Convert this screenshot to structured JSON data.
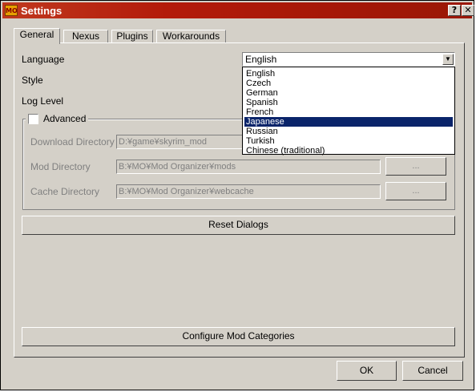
{
  "window": {
    "title": "Settings",
    "icon_text": "MO",
    "help_label": "?",
    "close_label": "✕"
  },
  "tabs": [
    "General",
    "Nexus",
    "Plugins",
    "Workarounds"
  ],
  "general": {
    "language_label": "Language",
    "language_value": "English",
    "style_label": "Style",
    "log_level_label": "Log Level",
    "advanced_label": "Advanced",
    "advanced_checked": false,
    "download_dir_label": "Download Directory",
    "download_dir_value": "D:¥game¥skyrim_mod",
    "mod_dir_label": "Mod Directory",
    "mod_dir_value": "B:¥MO¥Mod Organizer¥mods",
    "cache_dir_label": "Cache Directory",
    "cache_dir_value": "B:¥MO¥Mod Organizer¥webcache",
    "browse_label": "...",
    "reset_dialogs_label": "Reset Dialogs",
    "configure_categories_label": "Configure Mod Categories"
  },
  "language_dropdown": {
    "options": [
      "English",
      "Czech",
      "German",
      "Spanish",
      "French",
      "Japanese",
      "Russian",
      "Turkish",
      "Chinese (traditional)"
    ],
    "highlighted": "Japanese"
  },
  "footer": {
    "ok_label": "OK",
    "cancel_label": "Cancel"
  },
  "colors": {
    "title_bar": "#b31a0a",
    "selection": "#0a246a",
    "face": "#d4d0c8"
  }
}
